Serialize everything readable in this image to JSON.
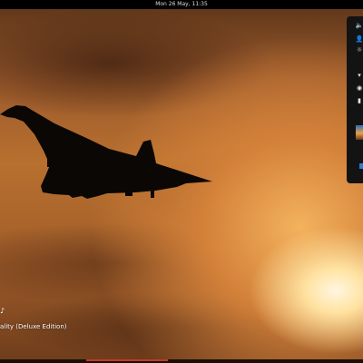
{
  "topbar": {
    "clock": "Mon 26 May, 11:35"
  },
  "status_panel": {
    "indicators": [
      {
        "name": "volume-icon",
        "glyph": "🔈"
      },
      {
        "name": "user-icon",
        "glyph": "👤"
      },
      {
        "name": "brightness-icon",
        "glyph": "☼"
      },
      {
        "name": "network-icon",
        "glyph": "▾"
      },
      {
        "name": "accessibility-icon",
        "glyph": "◉"
      },
      {
        "name": "battery-icon",
        "glyph": "▮"
      }
    ]
  },
  "notification": {
    "icon_glyph": "♪",
    "text": "ality (Deluxe Edition)"
  },
  "colors": {
    "accent": "#c0392b",
    "panel": "#131313",
    "topbar": "#000000"
  }
}
